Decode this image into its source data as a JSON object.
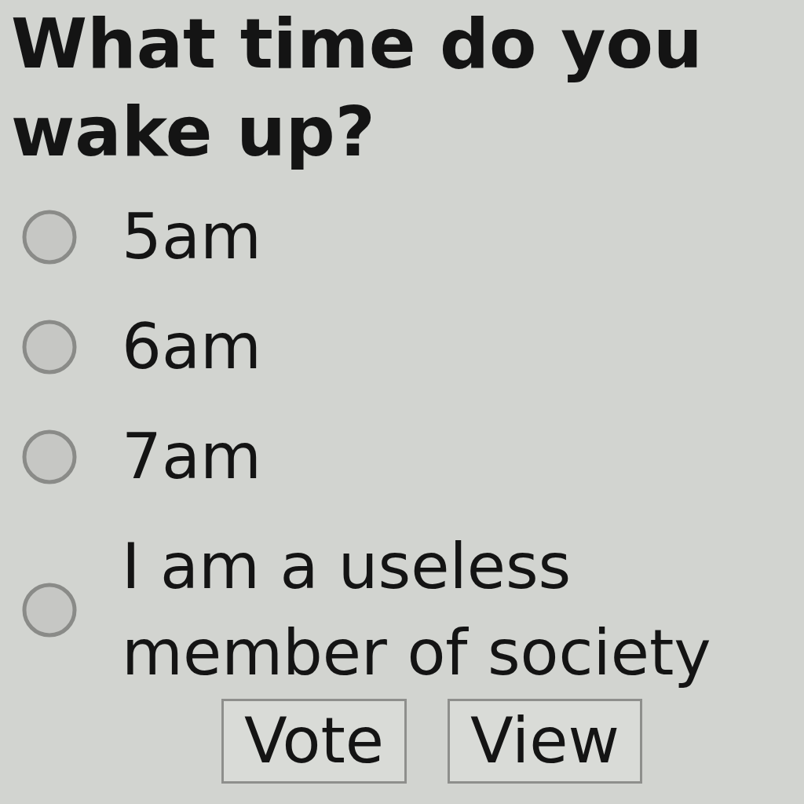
{
  "poll": {
    "question": "What time do you wake up?",
    "options": [
      {
        "label": "5am",
        "selected": false
      },
      {
        "label": "6am",
        "selected": false
      },
      {
        "label": "7am",
        "selected": false
      },
      {
        "label": "I am a useless member of society",
        "selected": false
      }
    ],
    "buttons": [
      "Vote",
      "View"
    ]
  }
}
